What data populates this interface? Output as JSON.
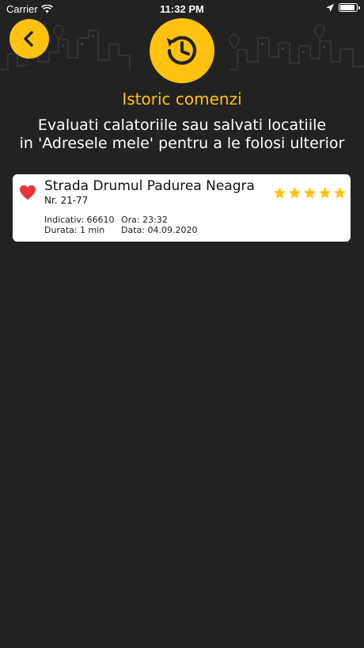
{
  "status_bar": {
    "carrier": "Carrier",
    "time": "11:32 PM"
  },
  "header": {
    "back_icon": "chevron-left-icon",
    "badge_icon": "history-clock-icon",
    "title": "Istoric comenzi",
    "subtitle_line1": "Evaluati calatoriile sau salvati locatiile",
    "subtitle_line2": "in 'Adresele mele' pentru a le folosi ulterior"
  },
  "trips": [
    {
      "street": "Strada Drumul Padurea Neagra",
      "number": "Nr. 21-77",
      "indicativ": "Indicativ: 66610",
      "ora": "Ora: 23:32",
      "durata": "Durata: 1 min",
      "data": "Data: 04.09.2020",
      "favorite": true,
      "rating": 5
    }
  ],
  "colors": {
    "background": "#222222",
    "accent": "#ffc20e",
    "heart": "#e8343c",
    "card": "#ffffff"
  }
}
